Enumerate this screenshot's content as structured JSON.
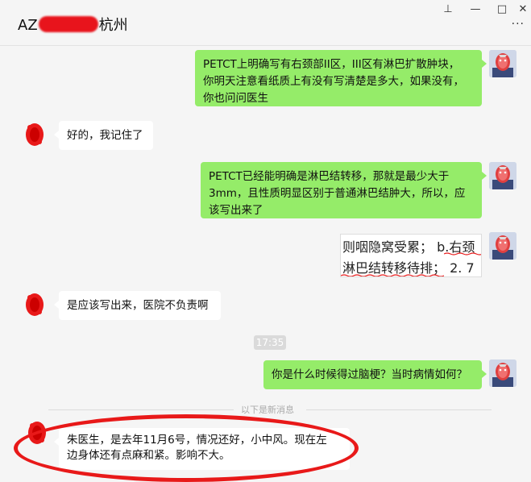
{
  "window": {
    "title_prefix": "AZ",
    "title_suffix": "杭州",
    "pin_glyph": "⊥",
    "minimize_glyph": "—",
    "maximize_glyph": "□",
    "close_glyph": "✕",
    "more_glyph": "···"
  },
  "messages": {
    "m1": {
      "line1": "PETCT上明确写有右颈部II区，III区有淋巴扩散肿块，",
      "line2": "你明天注意看纸质上有没有写清楚是多大，如果没有，",
      "line3": "你也问问医生"
    },
    "m2": {
      "text": "好的，我记住了"
    },
    "m3": {
      "line1": "PETCT已经能明确是淋巴结转移，那就是最少大于",
      "line2": "3mm，且性质明显区别于普通淋巴结肿大，所以，应",
      "line3": "该写出来了"
    },
    "m4": {
      "line1": "则咽隐窝受累； b.右颈",
      "line2": "淋巴结转移待排； 2. 7"
    },
    "m5": {
      "text": "是应该写出来，医院不负责啊"
    },
    "time": "17:35",
    "m6": {
      "text": "你是什么时候得过脑梗？当时病情如何？"
    },
    "divider": "以下是新消息",
    "m7": {
      "line1": "朱医生，是去年11月6号，情况还好，小中风。现在左",
      "line2": "边身体还有点麻和紧。影响不大。"
    }
  },
  "colors": {
    "my_bubble": "#95ec69",
    "their_bubble": "#ffffff",
    "annotation": "#e81919",
    "background": "#f5f5f5"
  }
}
